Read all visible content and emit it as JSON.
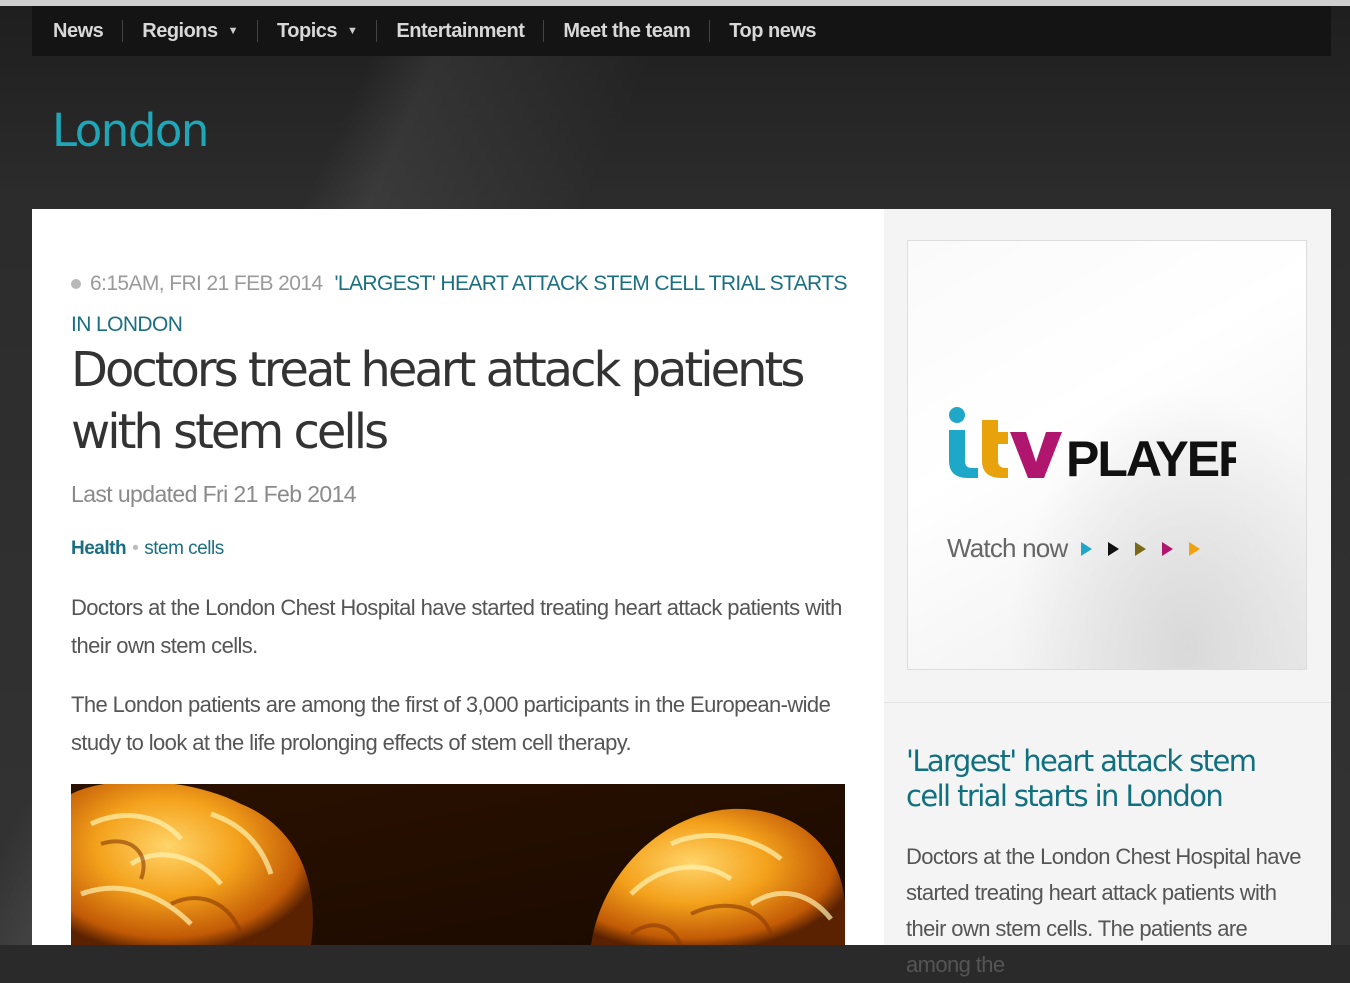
{
  "nav": {
    "items": [
      {
        "label": "News",
        "dropdown": false
      },
      {
        "label": "Regions",
        "dropdown": true
      },
      {
        "label": "Topics",
        "dropdown": true
      },
      {
        "label": "Entertainment",
        "dropdown": false
      },
      {
        "label": "Meet the team",
        "dropdown": false
      },
      {
        "label": "Top news",
        "dropdown": false
      }
    ]
  },
  "region": {
    "title": "London"
  },
  "article": {
    "timestamp": "6:15AM, FRI 21 FEB 2014",
    "story_link": "'LARGEST' HEART ATTACK STEM CELL TRIAL STARTS IN LONDON",
    "headline": "Doctors treat heart attack patients with stem cells",
    "last_updated": "Last updated Fri 21 Feb 2014",
    "tags": {
      "primary": "Health",
      "secondary": "stem cells"
    },
    "paragraphs": [
      "Doctors at the London Chest Hospital have started treating heart attack patients with their own stem cells.",
      "The London patients are among the first of 3,000 participants in the European-wide study to look at the life prolonging effects of stem cell therapy."
    ]
  },
  "sidebar": {
    "ad": {
      "logo_letters": "itv",
      "logo_word": "PLAYER",
      "cta": "Watch now",
      "arrow_colors": [
        "#1fa7c9",
        "#111111",
        "#7a6a18",
        "#b0166e",
        "#f2a20c"
      ],
      "logo_colors": {
        "i_dot": "#1fa7c9",
        "i": "#1fa7c9",
        "t": "#e8a20c",
        "v": "#b0166e",
        "word": "#111111"
      }
    },
    "related": {
      "title": "'Largest' heart attack stem cell trial starts in London",
      "summary": "Doctors at the London Chest Hospital have started treating heart attack patients with their own stem cells. The patients are among the"
    }
  },
  "colors": {
    "accent": "#1fa7b7",
    "link": "#1b6f80",
    "nav_bg": "#141414"
  }
}
